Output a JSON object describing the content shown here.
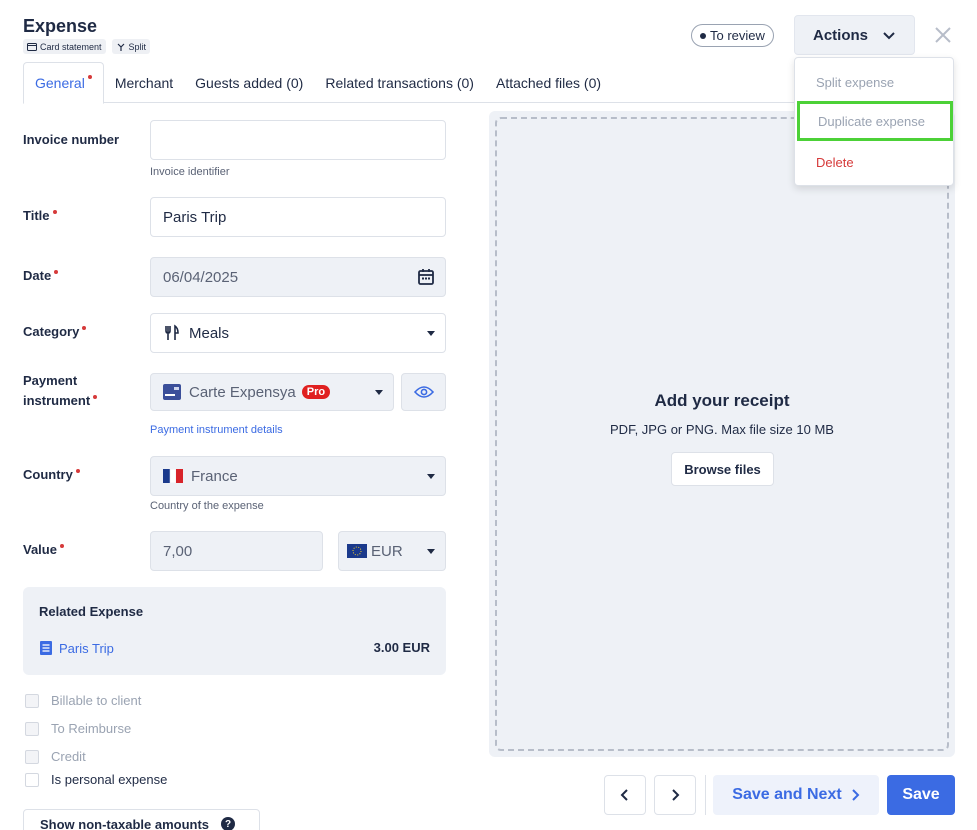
{
  "header": {
    "title": "Expense",
    "tags": [
      {
        "icon": "card-icon",
        "label": "Card statement"
      },
      {
        "icon": "split-icon",
        "label": "Split"
      }
    ],
    "status": "To review",
    "actions_label": "Actions"
  },
  "actions_menu": {
    "split": "Split expense",
    "duplicate": "Duplicate expense",
    "delete": "Delete"
  },
  "tabs": [
    {
      "label": "General",
      "required": true
    },
    {
      "label": "Merchant"
    },
    {
      "label": "Guests added (0)"
    },
    {
      "label": "Related transactions (0)"
    },
    {
      "label": "Attached files (0)"
    }
  ],
  "form": {
    "invoice_label": "Invoice number",
    "invoice_value": "",
    "invoice_helper": "Invoice identifier",
    "title_label": "Title",
    "title_value": "Paris Trip",
    "date_label": "Date",
    "date_value": "06/04/2025",
    "category_label": "Category",
    "category_value": "Meals",
    "payment_label_1": "Payment",
    "payment_label_2": "instrument",
    "payment_value": "Carte Expensya",
    "payment_badge": "Pro",
    "payment_link": "Payment instrument details",
    "country_label": "Country",
    "country_value": "France",
    "country_helper": "Country of the expense",
    "value_label": "Value",
    "value_amount": "7,00",
    "currency": "EUR"
  },
  "related": {
    "title": "Related Expense",
    "link": "Paris Trip",
    "amount": "3.00 EUR"
  },
  "checkboxes": {
    "billable": "Billable to client",
    "reimburse": "To Reimburse",
    "credit": "Credit",
    "personal": "Is personal expense"
  },
  "nontaxable_label": "Show non-taxable amounts",
  "receipt": {
    "title": "Add your receipt",
    "subtitle": "PDF, JPG or PNG. Max file size 10 MB",
    "browse": "Browse files"
  },
  "footer": {
    "save_next": "Save and Next",
    "save": "Save"
  },
  "colors": {
    "accent": "#3b6be3",
    "danger": "#d63a3a",
    "highlight": "#4cd137"
  }
}
